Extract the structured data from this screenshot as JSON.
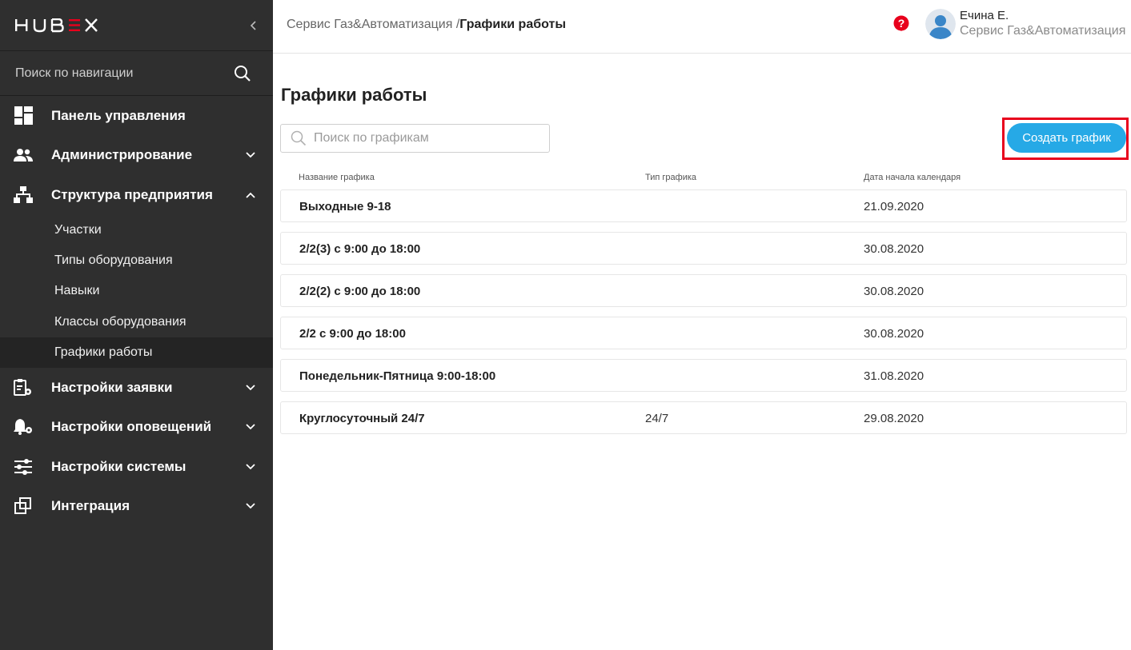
{
  "app": {
    "logo_text": "HUBEX",
    "brand_color": "#e8001c"
  },
  "sidebar": {
    "search_placeholder": "Поиск по навигации",
    "items": [
      {
        "label": "Панель управления",
        "icon": "dashboard-icon"
      },
      {
        "label": "Администрирование",
        "icon": "users-icon",
        "chevron": "down"
      },
      {
        "label": "Структура предприятия",
        "icon": "org-structure-icon",
        "chevron": "up"
      },
      {
        "label": "Настройки заявки",
        "icon": "request-settings-icon",
        "chevron": "down"
      },
      {
        "label": "Настройки оповещений",
        "icon": "notification-settings-icon",
        "chevron": "down"
      },
      {
        "label": "Настройки системы",
        "icon": "system-settings-icon",
        "chevron": "down"
      },
      {
        "label": "Интеграция",
        "icon": "integration-icon",
        "chevron": "down"
      }
    ],
    "subitems": [
      {
        "label": "Участки"
      },
      {
        "label": "Типы оборудования"
      },
      {
        "label": "Навыки"
      },
      {
        "label": "Классы оборудования"
      },
      {
        "label": "Графики работы",
        "active": true
      }
    ]
  },
  "header": {
    "breadcrumb_parent": "Сервис Газ&Автоматизация /",
    "breadcrumb_current": "Графики работы",
    "user_name": "Ечина Е.",
    "user_org": "Сервис Газ&Автоматизация"
  },
  "main": {
    "title": "Графики работы",
    "search_placeholder": "Поиск по графикам",
    "create_button": "Создать график",
    "columns": [
      "Название графика",
      "Тип графика",
      "Дата начала календаря"
    ],
    "rows": [
      {
        "name": "Выходные 9-18",
        "type": "",
        "date": "21.09.2020"
      },
      {
        "name": "2/2(3) с 9:00 до 18:00",
        "type": "",
        "date": "30.08.2020"
      },
      {
        "name": "2/2(2) с 9:00 до 18:00",
        "type": "",
        "date": "30.08.2020"
      },
      {
        "name": "2/2 с 9:00 до 18:00",
        "type": "",
        "date": "30.08.2020"
      },
      {
        "name": "Понедельник-Пятница 9:00-18:00",
        "type": "",
        "date": "31.08.2020"
      },
      {
        "name": "Круглосуточный 24/7",
        "type": "24/7",
        "date": "29.08.2020"
      }
    ]
  },
  "colors": {
    "sidebar_bg": "#2f2f2f",
    "accent": "#26a9e6",
    "highlight": "#e8001c"
  }
}
